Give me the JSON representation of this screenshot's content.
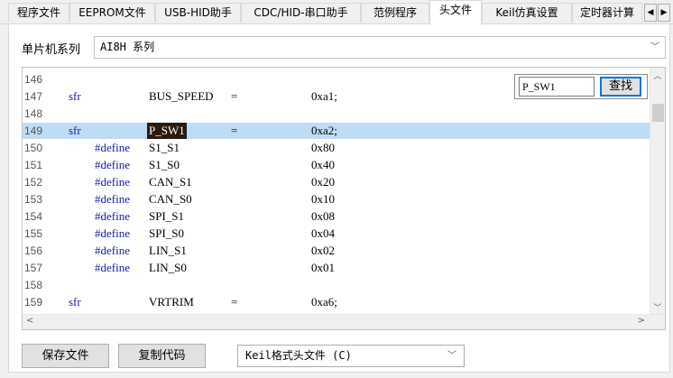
{
  "tabs": [
    {
      "label": "程序文件",
      "active": false
    },
    {
      "label": "EEPROM文件",
      "active": false
    },
    {
      "label": "USB-HID助手",
      "active": false
    },
    {
      "label": "CDC/HID-串口助手",
      "active": false
    },
    {
      "label": "范例程序",
      "active": false
    },
    {
      "label": "头文件",
      "active": true
    },
    {
      "label": "Keil仿真设置",
      "active": false
    },
    {
      "label": "定时器计算",
      "active": false
    }
  ],
  "tab_scroll": {
    "left": "◀",
    "right": "▶"
  },
  "series": {
    "label": "单片机系列",
    "value": "AI8H 系列"
  },
  "find": {
    "value": "P_SW1",
    "button": "查找"
  },
  "code_lines": [
    {
      "num": "146",
      "kind": "blank"
    },
    {
      "num": "147",
      "kind": "sfr",
      "keyword": "sfr",
      "name": "BUS_SPEED",
      "op": "=",
      "value": "0xa1;"
    },
    {
      "num": "148",
      "kind": "blank"
    },
    {
      "num": "149",
      "kind": "sfr",
      "keyword": "sfr",
      "name": "P_SW1",
      "op": "=",
      "value": "0xa2;",
      "highlight": true
    },
    {
      "num": "150",
      "kind": "define",
      "keyword": "#define",
      "name": "S1_S1",
      "value": "0x80"
    },
    {
      "num": "151",
      "kind": "define",
      "keyword": "#define",
      "name": "S1_S0",
      "value": "0x40"
    },
    {
      "num": "152",
      "kind": "define",
      "keyword": "#define",
      "name": "CAN_S1",
      "value": "0x20"
    },
    {
      "num": "153",
      "kind": "define",
      "keyword": "#define",
      "name": "CAN_S0",
      "value": "0x10"
    },
    {
      "num": "154",
      "kind": "define",
      "keyword": "#define",
      "name": "SPI_S1",
      "value": "0x08"
    },
    {
      "num": "155",
      "kind": "define",
      "keyword": "#define",
      "name": "SPI_S0",
      "value": "0x04"
    },
    {
      "num": "156",
      "kind": "define",
      "keyword": "#define",
      "name": "LIN_S1",
      "value": "0x02"
    },
    {
      "num": "157",
      "kind": "define",
      "keyword": "#define",
      "name": "LIN_S0",
      "value": "0x01"
    },
    {
      "num": "158",
      "kind": "blank"
    },
    {
      "num": "159",
      "kind": "sfr",
      "keyword": "sfr",
      "name": "VRTRIM",
      "op": "=",
      "value": "0xa6;"
    }
  ],
  "buttons": {
    "save": "保存文件",
    "copy": "复制代码"
  },
  "format": {
    "value": "Keil格式头文件 (C)"
  },
  "icons": {
    "dropdown": "chevron-down-icon",
    "scroll_up": "arrow-up-icon",
    "scroll_down": "arrow-down-icon",
    "scroll_left": "arrow-left-icon",
    "scroll_right": "arrow-right-icon"
  },
  "colors": {
    "keyword": "#1a1aa6",
    "highlight": "#bfdcf5",
    "focus_border": "#0078d7"
  }
}
